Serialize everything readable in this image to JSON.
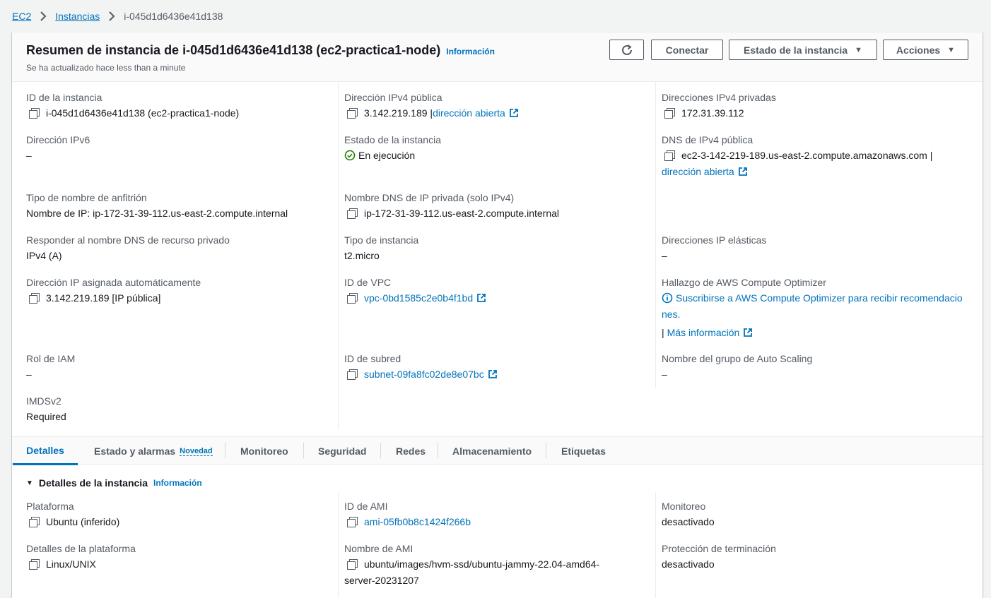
{
  "breadcrumb": {
    "items": [
      "EC2",
      "Instancias"
    ],
    "current": "i-045d1d6436e41d138"
  },
  "header": {
    "title": "Resumen de instancia de i-045d1d6436e41d138 (ec2-practica1-node)",
    "info": "Información",
    "subtitle": "Se ha actualizado hace less than a minute",
    "buttons": {
      "connect": "Conectar",
      "state": "Estado de la instancia",
      "actions": "Acciones"
    }
  },
  "summary": {
    "instance_id": {
      "label": "ID de la instancia",
      "value": "i-045d1d6436e41d138 (ec2-practica1-node)"
    },
    "public_ipv4": {
      "label": "Dirección IPv4 pública",
      "value": "3.142.219.189 |",
      "link": "dirección abierta"
    },
    "private_ipv4": {
      "label": "Direcciones IPv4 privadas",
      "value": "172.31.39.112"
    },
    "ipv6": {
      "label": "Dirección IPv6",
      "value": "–"
    },
    "state": {
      "label": "Estado de la instancia",
      "value": "En ejecución"
    },
    "public_dns": {
      "label": "DNS de IPv4 pública",
      "value": "ec2-3-142-219-189.us-east-2.compute.amazonaws.com |",
      "link": "dirección abierta"
    },
    "hostname_type": {
      "label": "Tipo de nombre de anfitrión",
      "value": "Nombre de IP: ip-172-31-39-112.us-east-2.compute.internal"
    },
    "private_dns": {
      "label": "Nombre DNS de IP privada (solo IPv4)",
      "value": "ip-172-31-39-112.us-east-2.compute.internal"
    },
    "resource_dns": {
      "label": "Responder al nombre DNS de recurso privado",
      "value": "IPv4 (A)"
    },
    "instance_type": {
      "label": "Tipo de instancia",
      "value": "t2.micro"
    },
    "elastic_ip": {
      "label": "Direcciones IP elásticas",
      "value": "–"
    },
    "auto_ip": {
      "label": "Dirección IP asignada automáticamente",
      "value": "3.142.219.189 [IP pública]"
    },
    "vpc": {
      "label": "ID de VPC",
      "value": "vpc-0bd1585c2e0b4f1bd"
    },
    "optimizer": {
      "label": "Hallazgo de AWS Compute Optimizer",
      "value_line1": "Suscribirse a AWS Compute Optimizer para recibir recomendacio",
      "value_line2": "nes.",
      "more_prefix": "|",
      "more": "Más información"
    },
    "iam": {
      "label": "Rol de IAM",
      "value": "–"
    },
    "subnet": {
      "label": "ID de subred",
      "value": "subnet-09fa8fc02de8e07bc"
    },
    "asg": {
      "label": "Nombre del grupo de Auto Scaling",
      "value": "–"
    },
    "imds": {
      "label": "IMDSv2",
      "value": "Required"
    }
  },
  "tabs": [
    {
      "label": "Detalles"
    },
    {
      "label": "Estado y alarmas",
      "badge": "Novedad"
    },
    {
      "label": "Monitoreo"
    },
    {
      "label": "Seguridad"
    },
    {
      "label": "Redes"
    },
    {
      "label": "Almacenamiento"
    },
    {
      "label": "Etiquetas"
    }
  ],
  "details": {
    "title": "Detalles de la instancia",
    "info": "Información",
    "platform": {
      "label": "Plataforma",
      "value": "Ubuntu (inferido)"
    },
    "ami_id": {
      "label": "ID de AMI",
      "value": "ami-05fb0b8c1424f266b"
    },
    "monitoring": {
      "label": "Monitoreo",
      "value": "desactivado"
    },
    "platform_details": {
      "label": "Detalles de la plataforma",
      "value": "Linux/UNIX"
    },
    "ami_name": {
      "label": "Nombre de AMI",
      "value_line1": "ubuntu/images/hvm-ssd/ubuntu-jammy-22.04-amd64-",
      "value_line2": "server-20231207"
    },
    "termination": {
      "label": "Protección de terminación",
      "value": "desactivado"
    }
  }
}
